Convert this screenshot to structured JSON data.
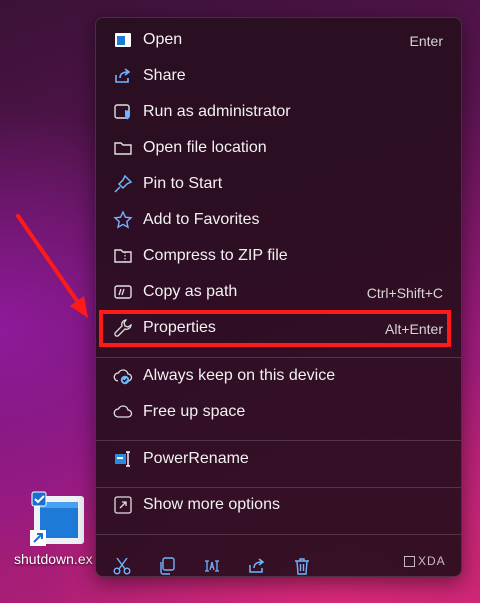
{
  "menu": {
    "items": [
      {
        "label": "Open",
        "shortcut": "Enter",
        "icon": "app-window-icon"
      },
      {
        "label": "Share",
        "shortcut": "",
        "icon": "share-icon"
      },
      {
        "label": "Run as administrator",
        "shortcut": "",
        "icon": "shield-window-icon"
      },
      {
        "label": "Open file location",
        "shortcut": "",
        "icon": "folder-icon"
      },
      {
        "label": "Pin to Start",
        "shortcut": "",
        "icon": "pin-icon"
      },
      {
        "label": "Add to Favorites",
        "shortcut": "",
        "icon": "star-icon"
      },
      {
        "label": "Compress to ZIP file",
        "shortcut": "",
        "icon": "zip-folder-icon"
      },
      {
        "label": "Copy as path",
        "shortcut": "Ctrl+Shift+C",
        "icon": "path-icon"
      },
      {
        "label": "Properties",
        "shortcut": "Alt+Enter",
        "icon": "wrench-icon"
      },
      {
        "label": "Always keep on this device",
        "shortcut": "",
        "icon": "cloud-check-icon"
      },
      {
        "label": "Free up space",
        "shortcut": "",
        "icon": "cloud-icon"
      },
      {
        "label": "PowerRename",
        "shortcut": "",
        "icon": "powerrename-icon"
      },
      {
        "label": "Show more options",
        "shortcut": "",
        "icon": "expand-icon"
      }
    ],
    "quick_actions": [
      "cut-icon",
      "copy-icon",
      "rename-icon",
      "share-icon",
      "delete-icon"
    ]
  },
  "desktop": {
    "file_label": "shutdown.ex"
  },
  "watermark": "XDA",
  "colors": {
    "highlight": "#ff1a1a",
    "menu_bg": "#280e1e",
    "accent": "#6fb5ff"
  }
}
